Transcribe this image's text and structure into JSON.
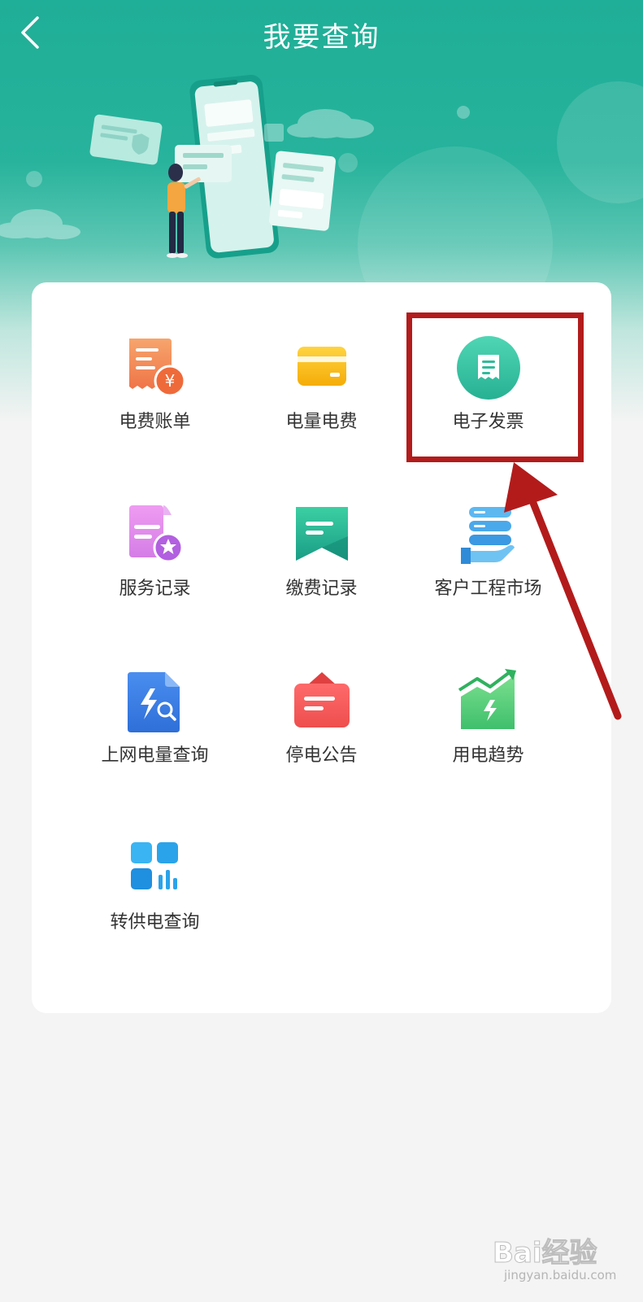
{
  "header": {
    "title": "我要查询",
    "back_icon": "chevron-left-icon",
    "background_color": "#1fae97"
  },
  "menu": {
    "items": [
      {
        "label": "电费账单",
        "icon": "bill-yuan-icon"
      },
      {
        "label": "电量电费",
        "icon": "card-icon"
      },
      {
        "label": "电子发票",
        "icon": "invoice-icon"
      },
      {
        "label": "服务记录",
        "icon": "document-star-icon"
      },
      {
        "label": "缴费记录",
        "icon": "bookmark-record-icon"
      },
      {
        "label": "客户工程市场",
        "icon": "stack-hand-icon"
      },
      {
        "label": "上网电量查询",
        "icon": "file-lightning-search-icon"
      },
      {
        "label": "停电公告",
        "icon": "announcement-icon"
      },
      {
        "label": "用电趋势",
        "icon": "trend-chart-icon"
      },
      {
        "label": "转供电查询",
        "icon": "grid-bars-icon"
      }
    ]
  },
  "annotation": {
    "highlighted_item": "电子发票",
    "color": "#b31b1b"
  },
  "watermark": {
    "brand": "Bai经验",
    "url": "jingyan.baidu.com"
  }
}
